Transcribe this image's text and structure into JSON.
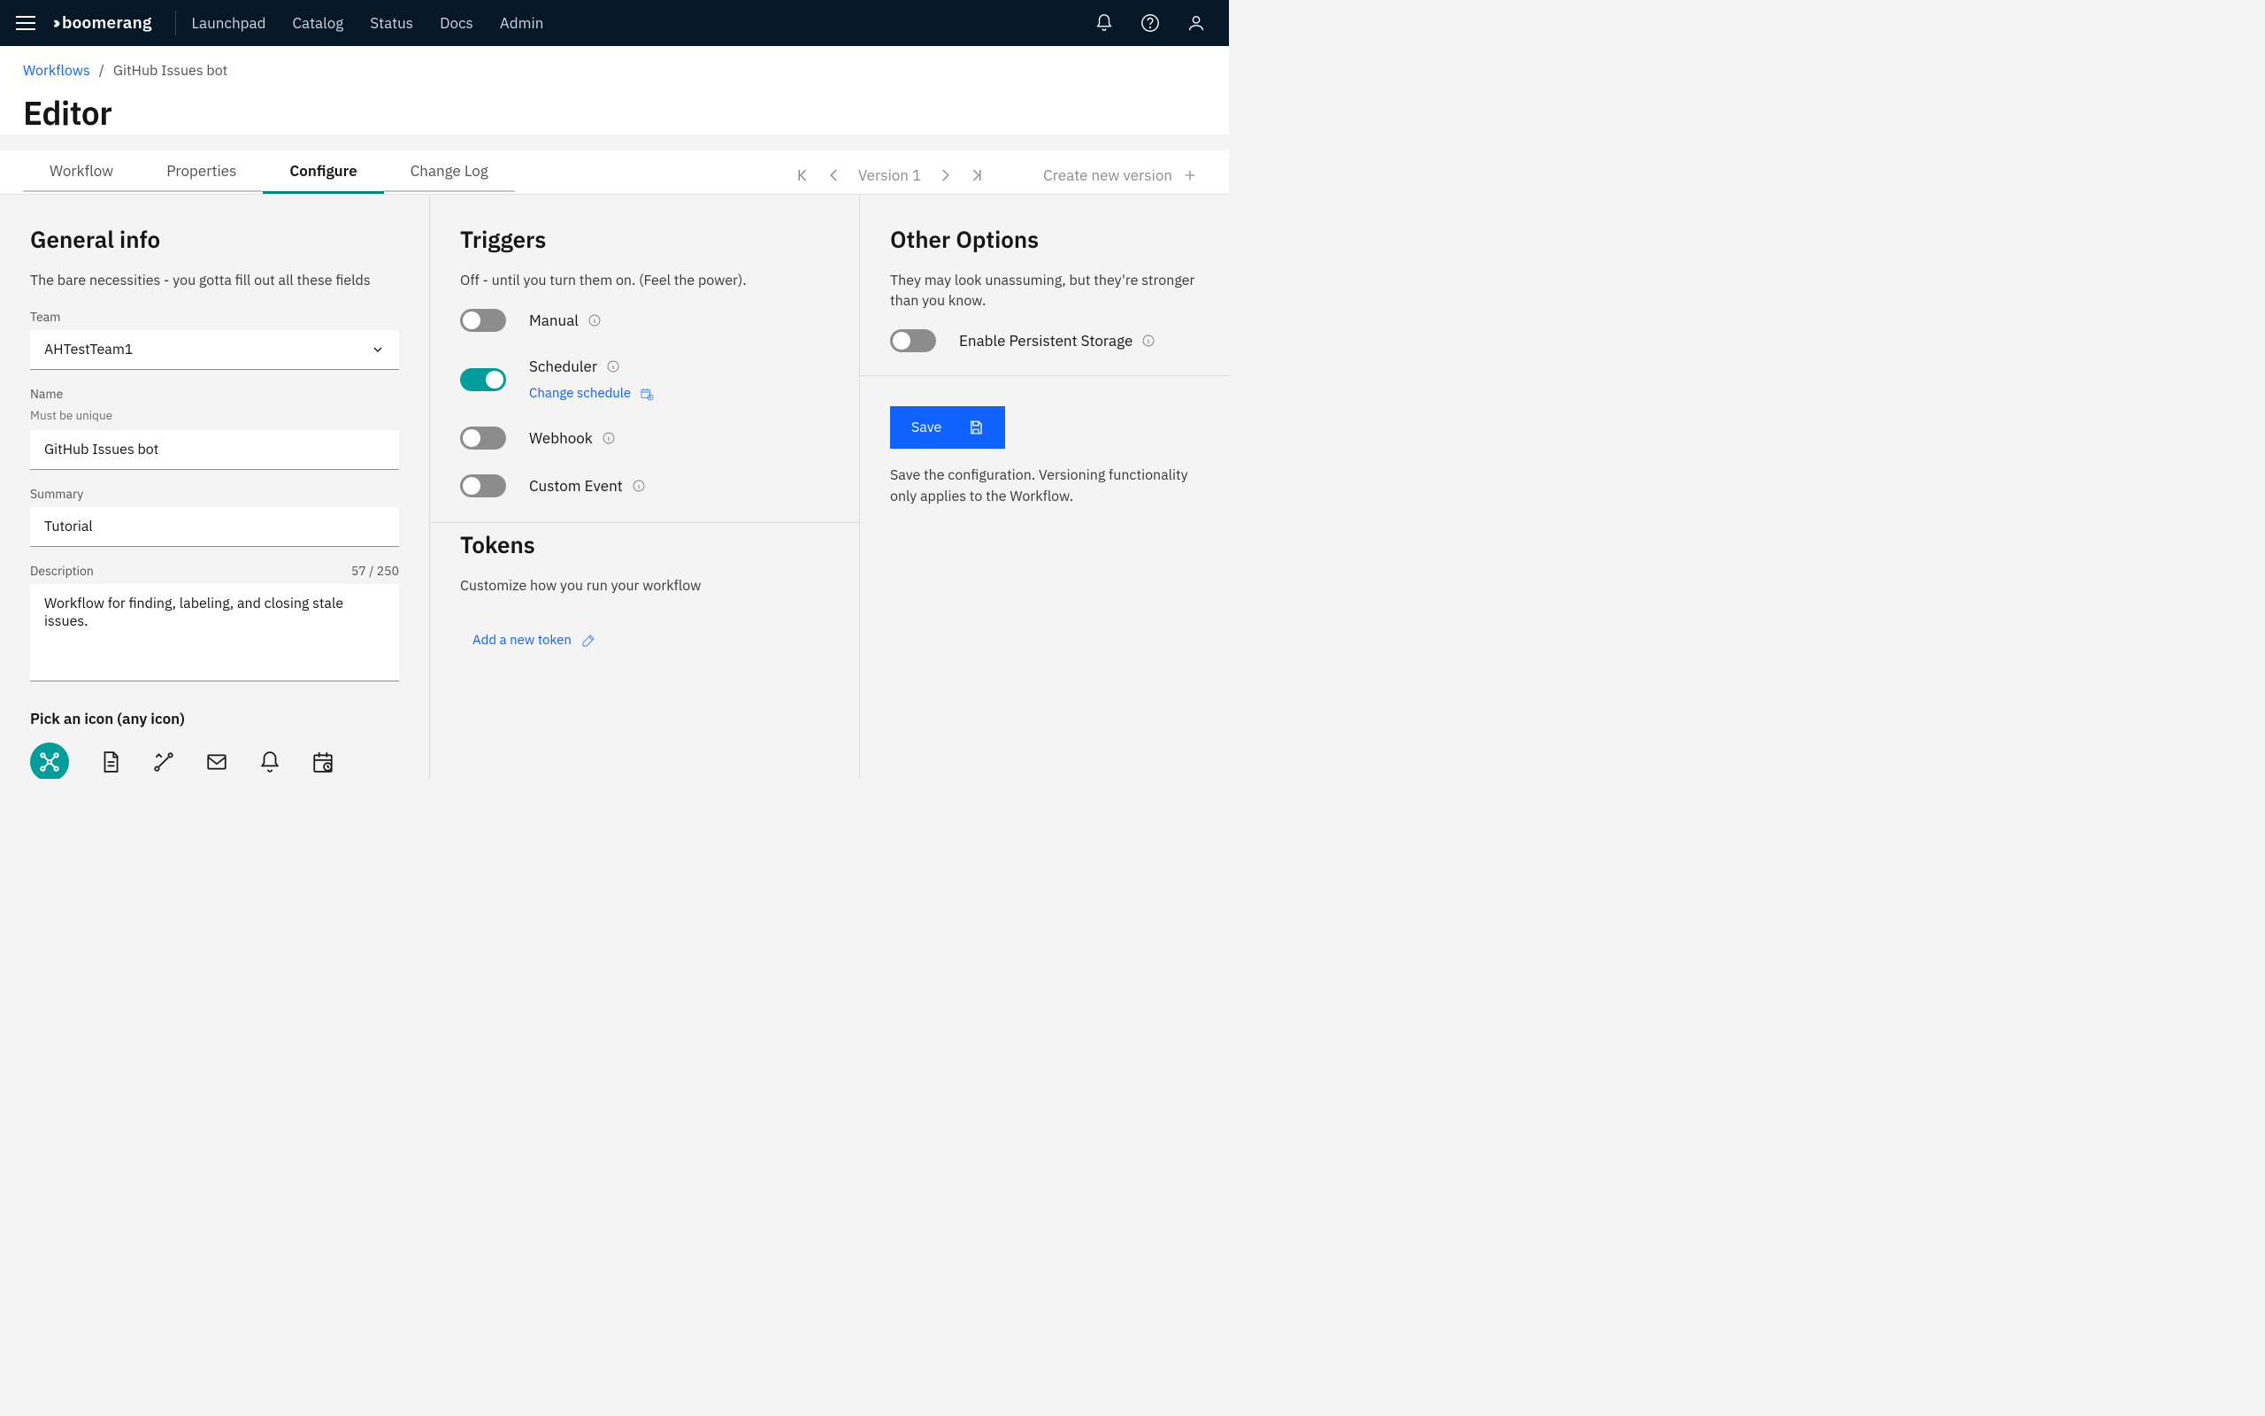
{
  "brand": "boomerang",
  "nav": {
    "items": [
      "Launchpad",
      "Catalog",
      "Status",
      "Docs",
      "Admin"
    ]
  },
  "breadcrumb": {
    "root": "Workflows",
    "current": "GitHub Issues bot"
  },
  "page_title": "Editor",
  "tabs": [
    "Workflow",
    "Properties",
    "Configure",
    "Change Log"
  ],
  "active_tab": "Configure",
  "version": {
    "label": "Version 1",
    "create_label": "Create new version"
  },
  "general": {
    "heading": "General info",
    "sub": "The bare necessities - you gotta fill out all these fields",
    "team_label": "Team",
    "team_value": "AHTestTeam1",
    "name_label": "Name",
    "name_help": "Must be unique",
    "name_value": "GitHub Issues bot",
    "summary_label": "Summary",
    "summary_value": "Tutorial",
    "description_label": "Description",
    "description_counter": "57 / 250",
    "description_value": "Workflow for finding, labeling, and closing stale issues.",
    "icon_heading": "Pick an icon (any icon)"
  },
  "triggers": {
    "heading": "Triggers",
    "sub": "Off - until you turn them on. (Feel the power).",
    "items": [
      {
        "label": "Manual",
        "on": false
      },
      {
        "label": "Scheduler",
        "on": true,
        "link": "Change schedule"
      },
      {
        "label": "Webhook",
        "on": false
      },
      {
        "label": "Custom Event",
        "on": false
      }
    ]
  },
  "tokens": {
    "heading": "Tokens",
    "sub": "Customize how you run your workflow",
    "add_label": "Add a new token"
  },
  "other": {
    "heading": "Other Options",
    "sub": "They may look unassuming, but they're stronger than you know.",
    "storage_label": "Enable Persistent Storage"
  },
  "save": {
    "button": "Save",
    "help": "Save the configuration. Versioning functionality only applies to the Workflow."
  }
}
